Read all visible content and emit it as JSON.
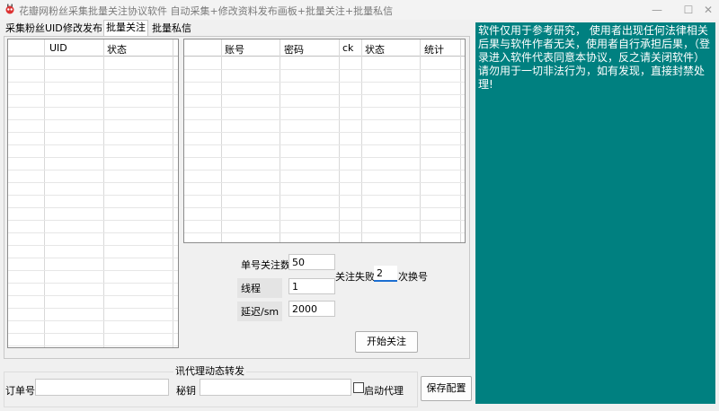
{
  "window": {
    "title": "花瓣网粉丝采集批量关注协议软件 自动采集+修改资料发布画板+批量关注+批量私信",
    "minimize": "—",
    "maximize": "☐",
    "close": "✕"
  },
  "tabs": [
    {
      "label": "采集粉丝UID"
    },
    {
      "label": "修改发布"
    },
    {
      "label": "批量关注"
    },
    {
      "label": "批量私信"
    }
  ],
  "active_tab": "批量关注",
  "uid_grid": {
    "columns": [
      "UID",
      "状态"
    ],
    "rows": []
  },
  "account_grid": {
    "columns": [
      "账号",
      "密码",
      "ck",
      "状态",
      "统计"
    ],
    "rows": []
  },
  "settings": {
    "follow_count_label": "单号关注数",
    "follow_count_value": "50",
    "fail_label": "关注失败",
    "fail_value": "2",
    "switch_label": "次换号",
    "threads_label": "线程",
    "threads_value": "1",
    "delay_label": "延迟/sm",
    "delay_value": "2000",
    "start_button": "开始关注"
  },
  "proxy": {
    "group_title": "讯代理动态转发",
    "order_label": "订单号",
    "order_value": "",
    "key_label": "秘钥",
    "key_value": "",
    "enable_label": "启动代理",
    "enabled": false
  },
  "save_button": "保存配置",
  "notice_text": "软件仅用于参考研究， 使用者出现任何法律相关后果与软件作者无关，使用者自行承担后果，（登录进入软件代表同意本协议，反之请关闭软件）请勿用于一切非法行为，如有发现，直接封禁处理!",
  "colors": {
    "notice_bg": "#008080",
    "notice_text": "#ffffff"
  }
}
